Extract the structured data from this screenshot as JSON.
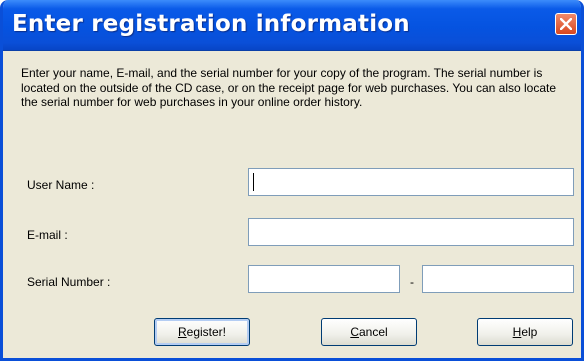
{
  "dialog": {
    "title": "Enter registration information",
    "description": "Enter your name, E-mail, and the serial number for your copy of the program. The serial number is located on the outside of the CD case, or on the receipt page for web purchases. You can also locate the serial number for web purchases in your online order history."
  },
  "form": {
    "user_name_label": "User Name :",
    "user_name_value": "",
    "email_label": "E-mail :",
    "email_value": "",
    "serial_label": "Serial Number :",
    "serial_part1_value": "",
    "serial_separator": "-",
    "serial_part2_value": ""
  },
  "buttons": {
    "register": {
      "mnemonic": "R",
      "rest": "egister!"
    },
    "cancel": {
      "mnemonic": "C",
      "rest": "ancel"
    },
    "help": {
      "mnemonic": "H",
      "rest": "elp"
    }
  },
  "icons": {
    "close": "close-icon"
  },
  "colors": {
    "titlebar": "#0a4fd8",
    "close": "#d9471f",
    "background": "#ece9d8"
  }
}
